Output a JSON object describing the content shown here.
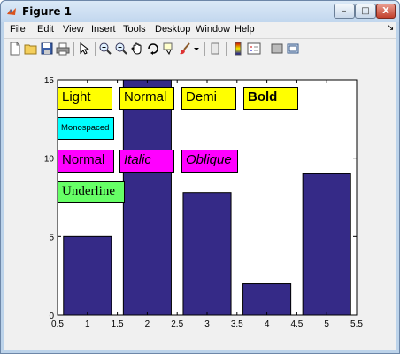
{
  "window": {
    "title": "Figure 1",
    "buttons": {
      "minimize": "–",
      "maximize": "□",
      "close": "X"
    }
  },
  "menubar": {
    "items": [
      "File",
      "Edit",
      "View",
      "Insert",
      "Tools",
      "Desktop",
      "Window",
      "Help"
    ],
    "dock_arrow": "↘"
  },
  "toolbar": {
    "icons": [
      "new-figure-icon",
      "open-file-icon",
      "save-icon",
      "print-icon",
      "edit-plot-icon",
      "zoom-in-icon",
      "zoom-out-icon",
      "pan-icon",
      "rotate-3d-icon",
      "data-cursor-icon",
      "brush-icon",
      "brush-dropdown-icon",
      "link-plot-icon",
      "insert-colorbar-icon",
      "insert-legend-icon",
      "hide-plot-tools-icon",
      "show-plot-tools-icon"
    ]
  },
  "chart_data": {
    "type": "bar",
    "x": [
      1,
      2,
      3,
      4,
      5
    ],
    "values": [
      5,
      15,
      7.8,
      2,
      9
    ],
    "bar_color": "#352a87",
    "xlim": [
      0.5,
      5.5
    ],
    "ylim": [
      0,
      15
    ],
    "xticks": [
      "0.5",
      "1",
      "1.5",
      "2",
      "2.5",
      "3",
      "3.5",
      "4",
      "4.5",
      "5",
      "5.5"
    ],
    "yticks": [
      "0",
      "5",
      "10",
      "15"
    ],
    "title": "",
    "xlabel": "",
    "ylabel": "",
    "grid": false
  },
  "annotations": [
    {
      "text": "Light",
      "bg": "#ffff00",
      "style": "light"
    },
    {
      "text": "Normal",
      "bg": "#ffff00",
      "style": "normal"
    },
    {
      "text": "Demi",
      "bg": "#ffff00",
      "style": "demi"
    },
    {
      "text": "Bold",
      "bg": "#ffff00",
      "style": "bold"
    },
    {
      "text": "Monospaced",
      "bg": "#00ffff",
      "style": "mono"
    },
    {
      "text": "Normal",
      "bg": "#ff00ff",
      "style": "normal"
    },
    {
      "text": "Italic",
      "bg": "#ff00ff",
      "style": "italic"
    },
    {
      "text": "Oblique",
      "bg": "#ff00ff",
      "style": "oblique"
    },
    {
      "text": "Underline",
      "bg": "#66ff66",
      "style": "serif"
    }
  ]
}
